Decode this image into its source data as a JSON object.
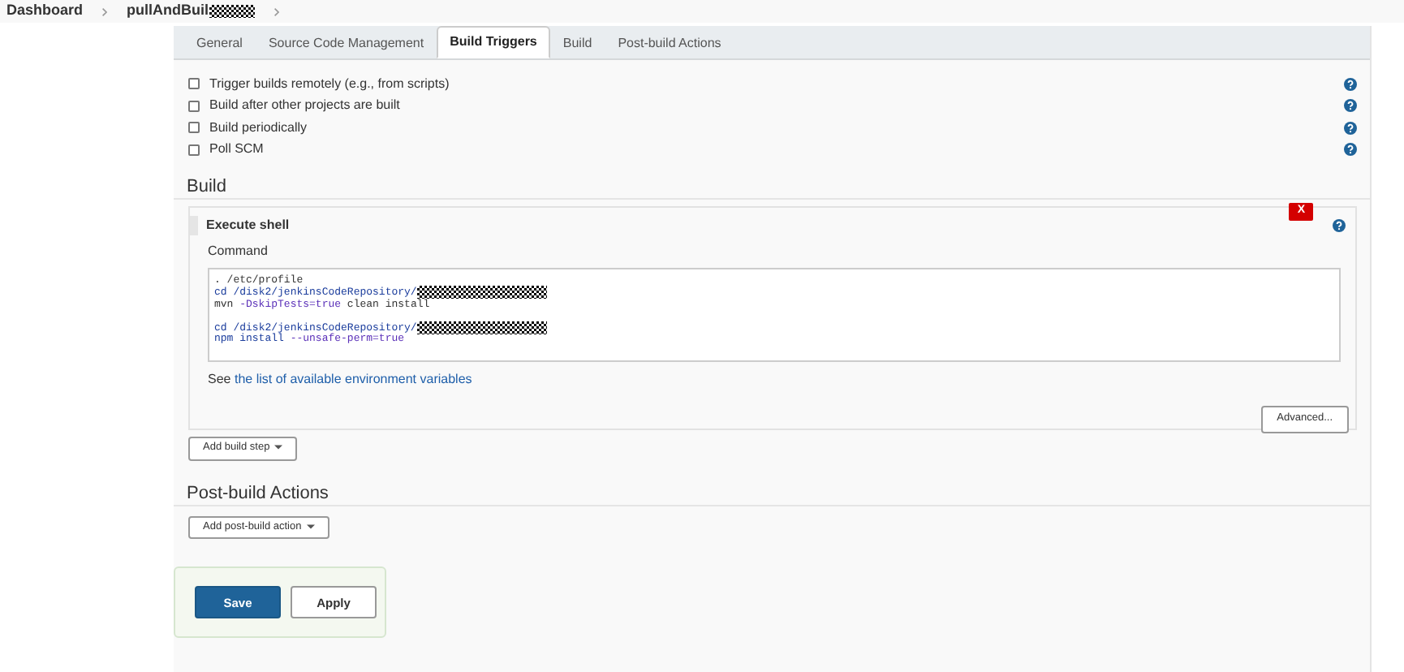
{
  "breadcrumb": [
    {
      "label": "Dashboard",
      "redacted": false
    },
    {
      "label": "pullAndBuil",
      "redacted": true
    }
  ],
  "tabs": [
    {
      "label": "General",
      "selected": false
    },
    {
      "label": "Source Code Management",
      "selected": false
    },
    {
      "label": "Build Triggers",
      "selected": true
    },
    {
      "label": "Build",
      "selected": false
    },
    {
      "label": "Post-build Actions",
      "selected": false
    }
  ],
  "triggers": [
    {
      "label": "Trigger builds remotely (e.g., from scripts)",
      "checked": false
    },
    {
      "label": "Build after other projects are built",
      "checked": false
    },
    {
      "label": "Build periodically",
      "checked": false
    },
    {
      "label": "Poll SCM",
      "checked": false
    }
  ],
  "build": {
    "heading": "Build",
    "step": {
      "title": "Execute shell",
      "field_label": "Command",
      "delete_label": "X",
      "lines": [
        {
          "segments": [
            {
              "text": ". /etc/profile",
              "kind": "plain"
            }
          ],
          "redacted": false
        },
        {
          "segments": [
            {
              "text": "cd",
              "kind": "keyword"
            },
            {
              "text": " /disk2/jenkinsCodeRepository/",
              "kind": "keyword"
            }
          ],
          "redacted": true
        },
        {
          "segments": [
            {
              "text": "mvn ",
              "kind": "plain"
            },
            {
              "text": "-DskipTests=true",
              "kind": "option"
            },
            {
              "text": " clean install",
              "kind": "plain"
            }
          ],
          "redacted": false
        },
        {
          "redacted": false
        },
        {
          "segments": [
            {
              "text": "cd",
              "kind": "keyword"
            },
            {
              "text": " /disk2/jenkinsCodeRepository/",
              "kind": "keyword"
            }
          ],
          "redacted": true
        },
        {
          "segments": [
            {
              "text": "npm",
              "kind": "keyword"
            },
            {
              "text": " install ",
              "kind": "keyword"
            },
            {
              "text": "--unsafe-perm=true",
              "kind": "option"
            }
          ],
          "redacted": false
        }
      ],
      "hint_prefix": "See",
      "hint_link": "the list of available environment variables",
      "advanced_button": "Advanced..."
    },
    "add_button": "Add build step"
  },
  "post_build": {
    "heading": "Post-build Actions",
    "add_button": "Add post-build action"
  },
  "actions": {
    "save": "Save",
    "apply": "Apply"
  }
}
